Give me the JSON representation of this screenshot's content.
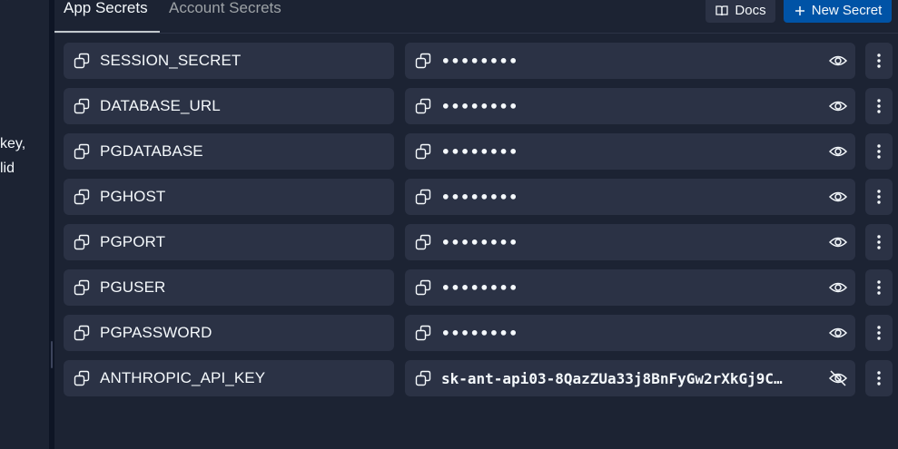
{
  "sidebar_fragments": {
    "line1": "key,",
    "line2": "lid"
  },
  "tabs": [
    {
      "label": "App Secrets",
      "active": true
    },
    {
      "label": "Account Secrets",
      "active": false
    }
  ],
  "toolbar": {
    "docs_label": "Docs",
    "new_secret_label": "New Secret"
  },
  "secrets": [
    {
      "key": "SESSION_SECRET",
      "value": "••••••••",
      "revealed": false
    },
    {
      "key": "DATABASE_URL",
      "value": "••••••••",
      "revealed": false
    },
    {
      "key": "PGDATABASE",
      "value": "••••••••",
      "revealed": false
    },
    {
      "key": "PGHOST",
      "value": "••••••••",
      "revealed": false
    },
    {
      "key": "PGPORT",
      "value": "••••••••",
      "revealed": false
    },
    {
      "key": "PGUSER",
      "value": "••••••••",
      "revealed": false
    },
    {
      "key": "PGPASSWORD",
      "value": "••••••••",
      "revealed": false
    },
    {
      "key": "ANTHROPIC_API_KEY",
      "value": "sk-ant-api03-8QazZUa33j8BnFyGw2rXkGj9C…",
      "revealed": true
    }
  ],
  "icons": {
    "copy": "copy-icon",
    "eye": "eye-icon",
    "eye_off": "eye-off-icon",
    "more": "more-vertical-icon",
    "book": "book-icon",
    "plus": "plus-icon"
  },
  "colors": {
    "background": "#1c2333",
    "cell": "#2b3245",
    "primary_button": "#0053a6",
    "text": "#f5f9fc",
    "muted_text": "#9da2a6"
  }
}
